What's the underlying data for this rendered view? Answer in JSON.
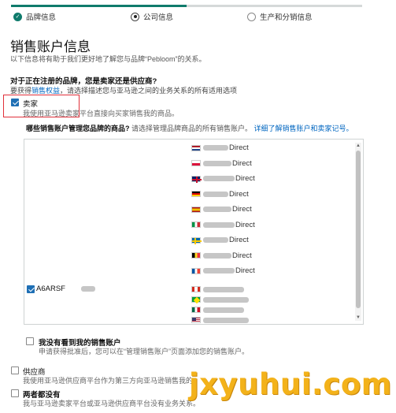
{
  "progress": {
    "fraction": 0.5,
    "accent": "#0f7b6c"
  },
  "steps": [
    {
      "label": "品牌信息",
      "state": "done"
    },
    {
      "label": "公司信息",
      "state": "current"
    },
    {
      "label": "生产和分销信息",
      "state": "todo"
    }
  ],
  "page": {
    "title": "销售账户信息",
    "subtitle": "以下信息将有助于我们更好地了解您与品牌“Pebloom”的关系。"
  },
  "question": {
    "label": "对于正在注册的品牌，您是卖家还是供应商?",
    "hint_prefix": "要获得",
    "hint_link": "销售权益",
    "hint_suffix": "，请选择描述您与亚马逊之间的业务关系的所有适用选项"
  },
  "options": {
    "seller": {
      "label": "卖家",
      "desc": "我使用亚马逊卖家平台直接向买家销售我的商品。",
      "checked": true
    },
    "vendor": {
      "label": "供应商",
      "desc": "我使用亚马逊供应商平台作为第三方向亚马逊销售我的",
      "checked": false
    },
    "neither": {
      "label": "两者都没有",
      "desc": "我与亚马逊卖家平台或亚马逊供应商平台没有业务关系。",
      "checked": false
    }
  },
  "accounts": {
    "question_bold": "哪些销售账户管理您品牌的商品?",
    "question_hint": "请选择管理品牌商品的所有销售账户。",
    "link": "详细了解销售账户和卖家记号。",
    "marketplaces": [
      {
        "flag": "nl-flag-icon",
        "suffix": "Direct"
      },
      {
        "flag": "pl-flag-icon",
        "suffix": "Direct"
      },
      {
        "flag": "gb-flag-icon",
        "suffix": "Direct"
      },
      {
        "flag": "de-flag-icon",
        "suffix": "Direct"
      },
      {
        "flag": "es-flag-icon",
        "suffix": "Direct"
      },
      {
        "flag": "it-flag-icon",
        "suffix": "Direct"
      },
      {
        "flag": "se-flag-icon",
        "suffix": "Direct"
      },
      {
        "flag": "be-flag-icon",
        "suffix": "Direct"
      },
      {
        "flag": "fr-flag-icon",
        "suffix": "Direct"
      }
    ],
    "seller_account": {
      "id": "A6ARSF",
      "checked": true,
      "marketplaces": [
        {
          "flag": "ca-flag-icon"
        },
        {
          "flag": "br-flag-icon"
        },
        {
          "flag": "mx-flag-icon"
        },
        {
          "flag": "us-flag-icon"
        }
      ]
    },
    "not_found": {
      "label": "我没有看到我的销售账户",
      "desc": "申请获得批准后，您可以在“管理销售账户”页面添加您的销售账户。",
      "checked": false
    }
  },
  "watermark": "jxyuhui.com"
}
